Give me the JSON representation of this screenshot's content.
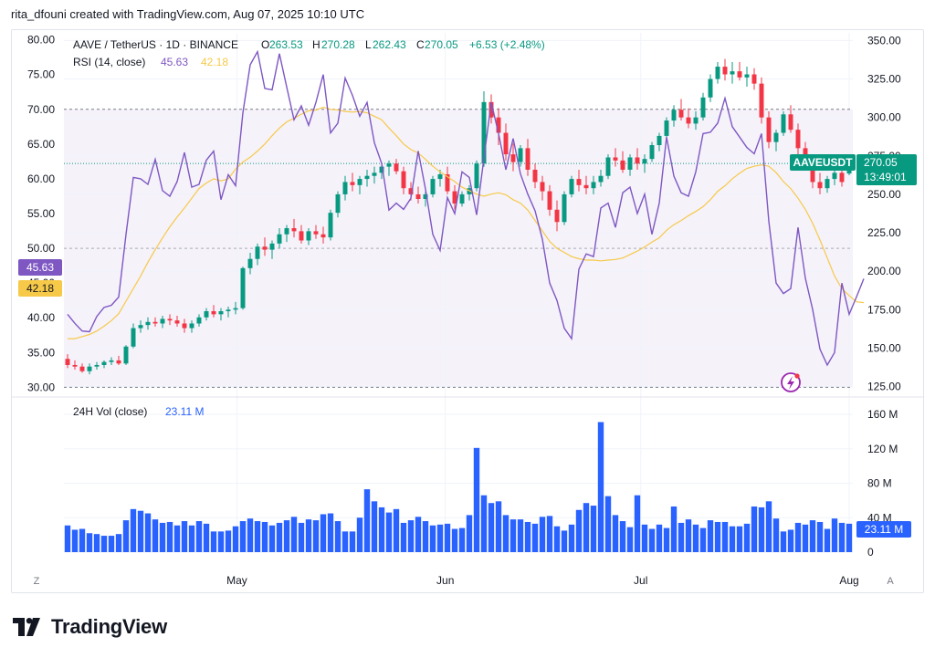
{
  "header": {
    "created_by": "rita_dfouni created with TradingView.com, Aug 07, 2025 10:10 UTC"
  },
  "legend": {
    "symbol": "AAVE / TetherUS · 1D · BINANCE",
    "open_label": "O",
    "open": "263.53",
    "high_label": "H",
    "high": "270.28",
    "low_label": "L",
    "low": "262.43",
    "close_label": "C",
    "close": "270.05",
    "change": "+6.53 (+2.48%)",
    "rsi_label": "RSI (14, close)",
    "rsi_value": "45.63",
    "rsi_ma_value": "42.18"
  },
  "volume_legend": {
    "label": "24H Vol (close)",
    "value": "23.11 M"
  },
  "price_badge": {
    "symbol": "AAVEUSDT",
    "price": "270.05",
    "countdown": "13:49:01"
  },
  "volume_badge": "23.11 M",
  "rsi_badge": "45.63",
  "rsi_ma_badge": "42.18",
  "footer": {
    "brand": "TradingView"
  },
  "bottom_bar": {
    "left_button": "Z",
    "right_button": "A"
  },
  "colors": {
    "up": "#089981",
    "down": "#f23645",
    "rsi": "#7e57c2",
    "rsi_ma": "#f7c948",
    "volume": "#2962ff",
    "badge_price": "#089981",
    "badge_rsi": "#7e57c2",
    "badge_ma": "#f7c948",
    "badge_vol": "#2962ff"
  },
  "chart_data": {
    "type": "candlestick",
    "x_labels": [
      "May",
      "Jun",
      "Jul",
      "Aug"
    ],
    "price_axis": {
      "ticks": [
        350,
        325,
        300,
        275,
        250,
        225,
        200,
        175,
        150,
        125
      ],
      "range": [
        120,
        355
      ]
    },
    "rsi_axis": {
      "ticks": [
        80,
        75,
        70,
        65,
        60,
        55,
        50,
        45,
        40,
        35,
        30
      ],
      "range": [
        29,
        81
      ],
      "bands": [
        30,
        70
      ],
      "midline": 50
    },
    "volume_axis": {
      "ticks": [
        160,
        120,
        80,
        40,
        0
      ],
      "tick_labels": [
        "160 M",
        "120 M",
        "80 M",
        "40 M",
        "0"
      ],
      "range": [
        0,
        160
      ]
    },
    "candles": [
      [
        143,
        146,
        137,
        139
      ],
      [
        139,
        142,
        136,
        138
      ],
      [
        138,
        140,
        134,
        135
      ],
      [
        135,
        140,
        133,
        138
      ],
      [
        138,
        141,
        136,
        139
      ],
      [
        139,
        142,
        137,
        141
      ],
      [
        141,
        144,
        139,
        142
      ],
      [
        142,
        145,
        139,
        140
      ],
      [
        140,
        152,
        139,
        151
      ],
      [
        151,
        166,
        150,
        163
      ],
      [
        163,
        168,
        160,
        165
      ],
      [
        165,
        170,
        162,
        167
      ],
      [
        167,
        170,
        164,
        166
      ],
      [
        166,
        171,
        163,
        169
      ],
      [
        169,
        172,
        165,
        168
      ],
      [
        168,
        171,
        164,
        166
      ],
      [
        166,
        169,
        160,
        163
      ],
      [
        163,
        168,
        160,
        166
      ],
      [
        166,
        172,
        164,
        170
      ],
      [
        170,
        176,
        168,
        174
      ],
      [
        174,
        178,
        170,
        172
      ],
      [
        172,
        176,
        168,
        174
      ],
      [
        174,
        177,
        170,
        175
      ],
      [
        175,
        180,
        172,
        176
      ],
      [
        176,
        203,
        175,
        202
      ],
      [
        202,
        212,
        198,
        208
      ],
      [
        208,
        218,
        204,
        216
      ],
      [
        216,
        222,
        210,
        214
      ],
      [
        214,
        220,
        208,
        218
      ],
      [
        218,
        228,
        215,
        224
      ],
      [
        224,
        230,
        219,
        228
      ],
      [
        228,
        234,
        222,
        226
      ],
      [
        226,
        230,
        218,
        220
      ],
      [
        220,
        228,
        217,
        226
      ],
      [
        226,
        230,
        221,
        224
      ],
      [
        224,
        229,
        218,
        222
      ],
      [
        222,
        240,
        220,
        238
      ],
      [
        238,
        252,
        235,
        250
      ],
      [
        250,
        262,
        246,
        258
      ],
      [
        258,
        264,
        252,
        256
      ],
      [
        256,
        262,
        250,
        260
      ],
      [
        260,
        266,
        255,
        262
      ],
      [
        262,
        268,
        257,
        264
      ],
      [
        264,
        270,
        260,
        268
      ],
      [
        268,
        272,
        262,
        270
      ],
      [
        270,
        273,
        263,
        265
      ],
      [
        265,
        268,
        250,
        254
      ],
      [
        254,
        258,
        246,
        250
      ],
      [
        250,
        255,
        244,
        247
      ],
      [
        247,
        252,
        242,
        250
      ],
      [
        250,
        262,
        248,
        260
      ],
      [
        260,
        266,
        255,
        263
      ],
      [
        263,
        268,
        250,
        252
      ],
      [
        252,
        256,
        240,
        244
      ],
      [
        244,
        252,
        242,
        250
      ],
      [
        250,
        256,
        246,
        254
      ],
      [
        254,
        272,
        252,
        270
      ],
      [
        270,
        317,
        268,
        310
      ],
      [
        310,
        315,
        296,
        300
      ],
      [
        300,
        306,
        282,
        290
      ],
      [
        290,
        296,
        272,
        276
      ],
      [
        276,
        283,
        265,
        271
      ],
      [
        271,
        282,
        268,
        280
      ],
      [
        280,
        286,
        262,
        266
      ],
      [
        266,
        270,
        254,
        258
      ],
      [
        258,
        262,
        246,
        252
      ],
      [
        252,
        256,
        236,
        240
      ],
      [
        240,
        246,
        226,
        232
      ],
      [
        232,
        252,
        230,
        250
      ],
      [
        250,
        262,
        248,
        260
      ],
      [
        260,
        266,
        252,
        256
      ],
      [
        256,
        262,
        250,
        254
      ],
      [
        254,
        262,
        250,
        258
      ],
      [
        258,
        266,
        255,
        262
      ],
      [
        262,
        276,
        260,
        274
      ],
      [
        274,
        280,
        268,
        272
      ],
      [
        272,
        278,
        264,
        266
      ],
      [
        266,
        276,
        262,
        274
      ],
      [
        274,
        280,
        266,
        270
      ],
      [
        270,
        276,
        264,
        273
      ],
      [
        273,
        284,
        271,
        282
      ],
      [
        282,
        290,
        278,
        288
      ],
      [
        288,
        300,
        286,
        298
      ],
      [
        298,
        308,
        294,
        305
      ],
      [
        305,
        312,
        298,
        300
      ],
      [
        300,
        306,
        293,
        296
      ],
      [
        296,
        304,
        292,
        300
      ],
      [
        300,
        316,
        298,
        313
      ],
      [
        313,
        328,
        310,
        325
      ],
      [
        325,
        336,
        322,
        333
      ],
      [
        333,
        338,
        324,
        328
      ],
      [
        328,
        336,
        322,
        330
      ],
      [
        330,
        336,
        324,
        326
      ],
      [
        326,
        333,
        320,
        328
      ],
      [
        328,
        332,
        318,
        322
      ],
      [
        322,
        326,
        296,
        300
      ],
      [
        300,
        304,
        280,
        284
      ],
      [
        284,
        292,
        278,
        290
      ],
      [
        290,
        304,
        288,
        302
      ],
      [
        302,
        308,
        290,
        292
      ],
      [
        292,
        296,
        276,
        280
      ],
      [
        280,
        284,
        266,
        270
      ],
      [
        270,
        276,
        254,
        258
      ],
      [
        258,
        264,
        250,
        254
      ],
      [
        254,
        262,
        251,
        260
      ],
      [
        260,
        268,
        256,
        264
      ],
      [
        264,
        268,
        255,
        258
      ],
      [
        263.53,
        270.28,
        262.43,
        270.05
      ]
    ],
    "rsi": [
      40.5,
      39.2,
      38.1,
      38.0,
      40.2,
      41.5,
      41.8,
      43.0,
      52.0,
      60.2,
      60.0,
      59.2,
      62.8,
      58.3,
      57.5,
      59.6,
      63.8,
      58.8,
      59.2,
      62.7,
      64.0,
      57.0,
      60.6,
      59.0,
      69.5,
      76.4,
      78.3,
      73.0,
      72.8,
      78.0,
      73.2,
      68.5,
      70.5,
      67.7,
      71.0,
      75.0,
      66.6,
      68.0,
      74.5,
      72.0,
      69.0,
      71.0,
      65.2,
      62.2,
      55.5,
      56.5,
      55.6,
      57.2,
      64.0,
      58.5,
      52.0,
      49.7,
      57.3,
      55.0,
      61.0,
      60.2,
      54.8,
      63.0,
      71.0,
      66.5,
      61.3,
      65.8,
      60.7,
      57.8,
      55.4,
      51.3,
      45.0,
      42.5,
      38.5,
      37.0,
      47.0,
      49.2,
      48.8,
      55.8,
      56.5,
      53.0,
      58.0,
      58.8,
      55.0,
      57.8,
      52.0,
      56.5,
      66.0,
      60.4,
      58.0,
      57.5,
      61.0,
      66.5,
      66.7,
      68.0,
      71.6,
      67.5,
      66.0,
      64.5,
      63.6,
      66.5,
      53.9,
      45.0,
      43.5,
      44.2,
      53.0,
      45.7,
      41.2,
      35.5,
      33.2,
      35.0,
      45.0,
      40.5,
      43.0,
      45.63
    ],
    "rsi_ma": [
      37.0,
      37.0,
      37.3,
      37.6,
      38.1,
      38.8,
      39.6,
      40.6,
      42.4,
      44.2,
      46.0,
      48.0,
      49.8,
      51.5,
      53.1,
      54.5,
      55.8,
      57.2,
      58.6,
      59.4,
      60.0,
      59.7,
      60.0,
      61.4,
      62.4,
      63.1,
      64.0,
      65.0,
      66.2,
      67.3,
      68.2,
      68.7,
      69.3,
      69.8,
      69.9,
      70.3,
      70.0,
      69.9,
      69.7,
      69.6,
      69.7,
      69.5,
      69.0,
      68.5,
      67.3,
      66.2,
      65.0,
      64.2,
      63.7,
      62.8,
      61.8,
      61.0,
      60.3,
      59.6,
      58.8,
      58.3,
      57.8,
      57.5,
      57.8,
      58.0,
      57.7,
      57.0,
      56.5,
      55.5,
      54.0,
      52.5,
      51.0,
      50.0,
      49.4,
      48.8,
      48.5,
      48.3,
      48.3,
      48.2,
      48.3,
      48.4,
      48.6,
      49.1,
      49.6,
      50.2,
      50.9,
      51.5,
      52.6,
      53.4,
      54.0,
      54.7,
      55.3,
      56.0,
      57.0,
      58.2,
      59.0,
      60.0,
      60.8,
      61.5,
      61.8,
      62.0,
      61.8,
      60.9,
      59.6,
      58.6,
      57.2,
      55.6,
      53.6,
      51.2,
      48.6,
      46.0,
      44.2,
      43.2,
      42.3,
      42.18
    ],
    "volume": [
      31,
      26,
      27,
      22,
      21,
      19,
      19,
      21,
      37,
      50,
      48,
      45,
      38,
      34,
      35,
      31,
      36,
      31,
      36,
      33,
      24,
      24,
      25,
      30,
      36,
      39,
      36,
      35,
      31,
      34,
      37,
      41,
      34,
      38,
      37,
      44,
      45,
      36,
      24,
      24,
      40,
      73,
      59,
      52,
      46,
      50,
      34,
      37,
      41,
      36,
      31,
      32,
      33,
      27,
      28,
      43,
      121,
      66,
      57,
      59,
      43,
      38,
      38,
      35,
      33,
      41,
      42,
      30,
      25,
      32,
      49,
      57,
      54,
      151,
      65,
      43,
      36,
      29,
      66,
      32,
      27,
      32,
      28,
      53,
      34,
      38,
      32,
      28,
      37,
      35,
      35,
      30,
      30,
      33,
      53,
      52,
      59,
      39,
      24,
      26,
      34,
      32,
      37,
      35,
      27,
      39,
      34,
      33,
      48,
      58,
      25,
      61,
      43,
      29,
      25,
      39,
      32,
      27,
      38,
      35,
      30,
      36,
      33,
      26,
      22,
      30,
      31,
      27,
      28,
      33
    ]
  }
}
